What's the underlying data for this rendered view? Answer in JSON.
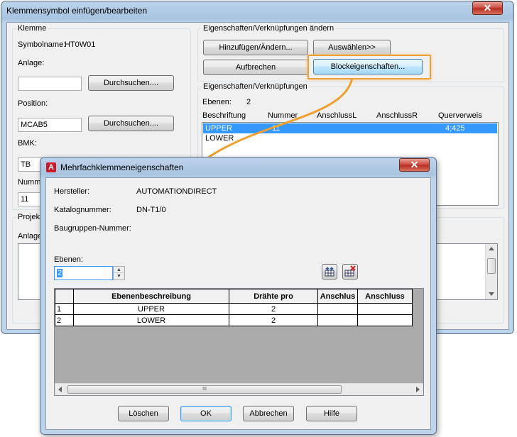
{
  "main_window": {
    "title": "Klemmensymbol einfügen/bearbeiten",
    "close_glyph": "✕",
    "klemme": {
      "legend": "Klemme",
      "symbolname_label": "Symbolname:",
      "symbolname_value": "HT0W01",
      "anlage_label": "Anlage:",
      "anlage_value": "",
      "browse_label": "Durchsuchen....",
      "position_label": "Position:",
      "position_value": "MCAB5",
      "bmk_label": "BMK:",
      "bmk_value": "TB",
      "nummer_label": "Numme",
      "nummer_value": "11"
    },
    "links": {
      "legend": "Eigenschaften/Verknüpfungen ändern",
      "add_change_label": "Hinzufügen/Ändern...",
      "select_label": "Auswählen>>",
      "break_label": "Aufbrechen",
      "block_props_label": "Blockeigenschaften..."
    },
    "props": {
      "legend": "Eigenschaften/Verknüpfungen",
      "ebenen_label": "Ebenen:",
      "ebenen_value": "2",
      "columns": [
        "Beschriftung",
        "Nummer",
        "AnschlussL",
        "AnschlussR",
        "Querverweis"
      ],
      "rows": [
        {
          "beschriftung": "UPPER",
          "nummer": "11",
          "anschlussL": "",
          "anschlussR": "",
          "querverweis": "4;425"
        },
        {
          "beschriftung": "LOWER",
          "nummer": "",
          "anschlussL": "",
          "anschlussR": "",
          "querverweis": ""
        }
      ]
    },
    "projekt": {
      "legend": "Projekt",
      "anlage_label": "Anlage"
    }
  },
  "dialog": {
    "title": "Mehrfachklemmeneigenschaften",
    "app_icon_letter": "A",
    "close_glyph": "✕",
    "hersteller_label": "Hersteller:",
    "hersteller_value": "AUTOMATIONDIRECT",
    "katalog_label": "Katalognummer:",
    "katalog_value": "DN-T1/0",
    "baugruppe_label": "Baugruppen-Nummer:",
    "baugruppe_value": "",
    "ebenen_label": "Ebenen:",
    "ebenen_value": "2",
    "spinner_up": "▲",
    "spinner_down": "▼",
    "table": {
      "columns": [
        "",
        "Ebenenbeschreibung",
        "Drähte pro",
        "Anschlus",
        "Anschluss"
      ],
      "rows": [
        {
          "num": "1",
          "desc": "UPPER",
          "wires": "2",
          "a1": "",
          "a2": ""
        },
        {
          "num": "2",
          "desc": "LOWER",
          "wires": "2",
          "a1": "",
          "a2": ""
        }
      ]
    },
    "hscroll_grip": "III",
    "buttons": {
      "delete": "Löschen",
      "ok": "OK",
      "cancel": "Abbrechen",
      "help": "Hilfe"
    }
  },
  "colors": {
    "selection": "#3399ff",
    "highlight_callout": "#f0a030"
  }
}
